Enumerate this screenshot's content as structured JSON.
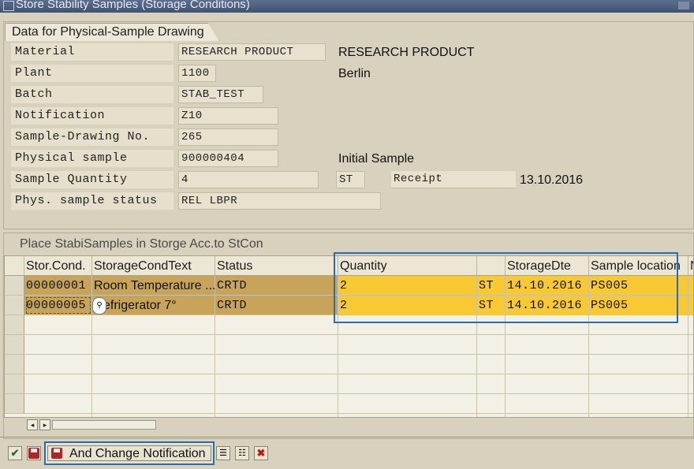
{
  "window": {
    "title": "Store Stability Samples (Storage Conditions)"
  },
  "section1": {
    "title": "Data for Physical-Sample Drawing",
    "fields": [
      {
        "label": "Material",
        "value": "RESEARCH PRODUCT",
        "desc": "RESEARCH PRODUCT"
      },
      {
        "label": "Plant",
        "value": "1100",
        "desc": "Berlin"
      },
      {
        "label": "Batch",
        "value": "STAB_TEST"
      },
      {
        "label": "Notification",
        "value": "Z10"
      },
      {
        "label": "Sample-Drawing No.",
        "value": "265"
      },
      {
        "label": "Physical sample",
        "value": "900000404",
        "desc": "Initial Sample"
      },
      {
        "label": "Sample Quantity",
        "value": "4",
        "unit": "ST",
        "receipt_label": "Receipt",
        "receipt_date": "13.10.2016"
      },
      {
        "label": "Phys. sample status",
        "value": "REL  LBPR"
      }
    ]
  },
  "section2": {
    "title": "Place StabiSamples in Storge Acc.to StCon",
    "columns": [
      "Stor.Cond.",
      "StorageCondText",
      "Status",
      "Quantity",
      "",
      "StorageDte",
      "Sample location",
      "N"
    ],
    "rows": [
      {
        "stor_cond": "00000001",
        "text": "Room Temperature ...",
        "status": "CRTD",
        "qty": "2",
        "unit": "ST",
        "date": "14.10.2016",
        "location": "PS005"
      },
      {
        "stor_cond": "00000005",
        "text": "efrigerator 7°",
        "status": "CRTD",
        "qty": "2",
        "unit": "ST",
        "date": "14.10.2016",
        "location": "PS005"
      }
    ]
  },
  "toolbar": {
    "and_change_label": "And Change Notification"
  },
  "icons": {
    "check": "check-icon",
    "save": "save-icon",
    "details": "details-icon",
    "delete": "delete-icon",
    "search": "search-help-icon"
  },
  "colors": {
    "highlight_row": "#f9c934",
    "selected_cell": "#c8a45b",
    "frame_blue": "#2b6cb0"
  }
}
